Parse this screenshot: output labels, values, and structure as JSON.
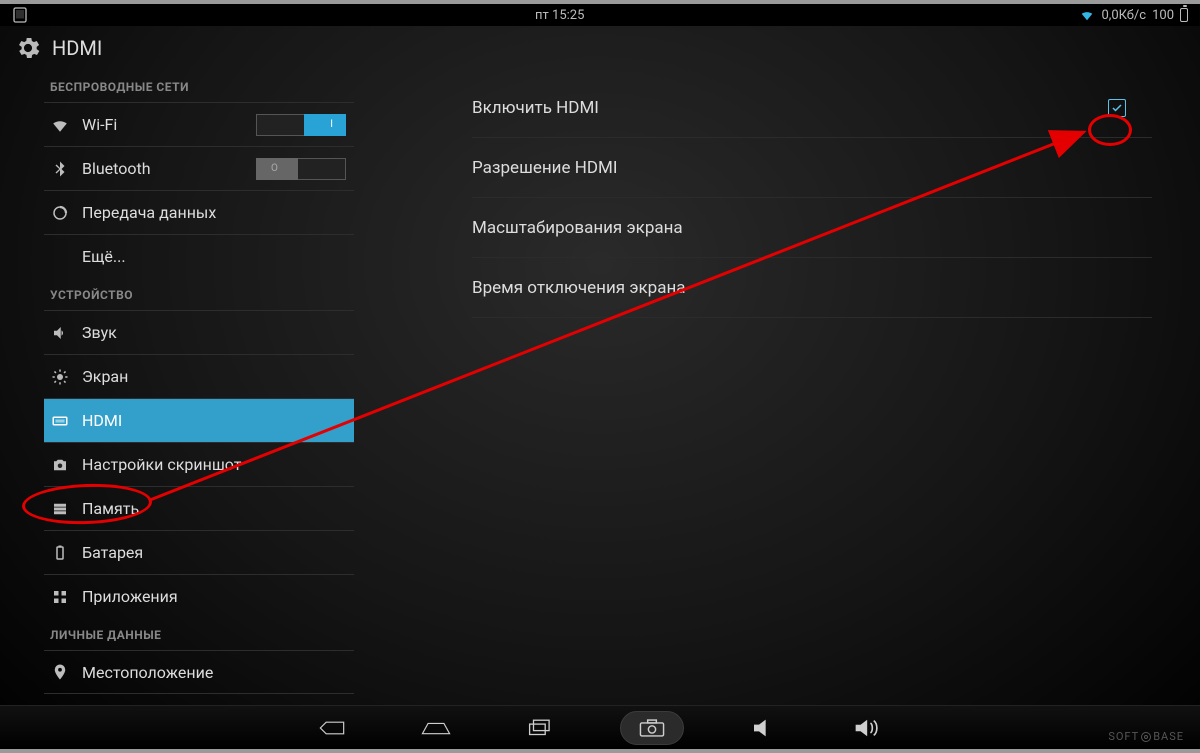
{
  "statusbar": {
    "time": "пт 15:25",
    "net_speed": "0,0Кб/с",
    "battery": "100"
  },
  "actionbar": {
    "title": "HDMI"
  },
  "sidebar": {
    "sections": [
      {
        "header": "БЕСПРОВОДНЫЕ СЕТИ",
        "items": [
          {
            "id": "wifi",
            "label": "Wi-Fi",
            "toggle": "on",
            "toggle_label": "I"
          },
          {
            "id": "bluetooth",
            "label": "Bluetooth",
            "toggle": "off",
            "toggle_label": "O"
          },
          {
            "id": "data-usage",
            "label": "Передача данных"
          },
          {
            "id": "more",
            "label": "Ещё..."
          }
        ]
      },
      {
        "header": "УСТРОЙСТВО",
        "items": [
          {
            "id": "sound",
            "label": "Звук"
          },
          {
            "id": "display",
            "label": "Экран"
          },
          {
            "id": "hdmi",
            "label": "HDMI",
            "selected": true
          },
          {
            "id": "screenshot",
            "label": "Настройки скриншот"
          },
          {
            "id": "storage",
            "label": "Память"
          },
          {
            "id": "battery",
            "label": "Батарея"
          },
          {
            "id": "apps",
            "label": "Приложения"
          }
        ]
      },
      {
        "header": "ЛИЧНЫЕ ДАННЫЕ",
        "items": [
          {
            "id": "location",
            "label": "Местоположение"
          }
        ]
      }
    ]
  },
  "content": {
    "rows": [
      {
        "id": "enable-hdmi",
        "label": "Включить HDMI",
        "checked": true
      },
      {
        "id": "hdmi-resolution",
        "label": "Разрешение HDMI"
      },
      {
        "id": "screen-scale",
        "label": "Масштабирования экрана"
      },
      {
        "id": "screen-off-time",
        "label": "Время отключения экрана"
      }
    ]
  },
  "watermark": {
    "left": "SOFT",
    "right": "BASE"
  }
}
